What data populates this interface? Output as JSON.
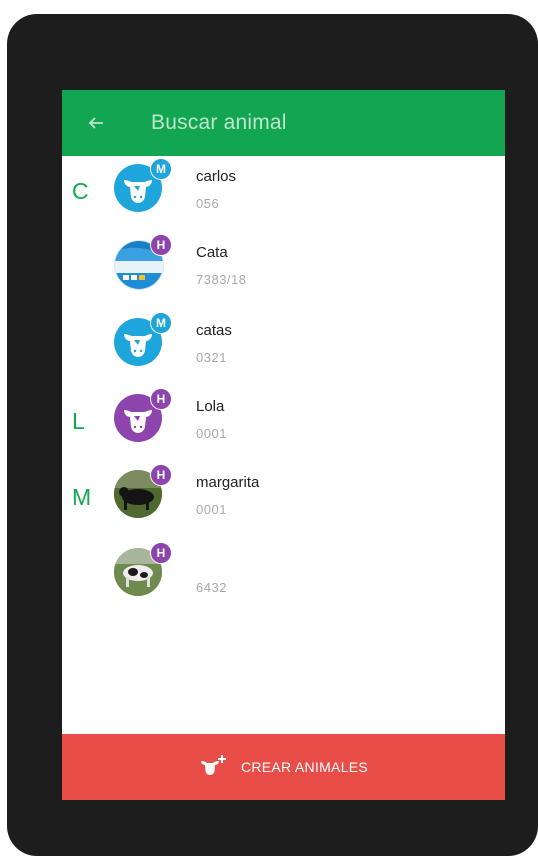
{
  "header": {
    "title": "Buscar animal",
    "back_icon": "arrow-back-icon"
  },
  "colors": {
    "primary": "#12a552",
    "accent": "#e84d47",
    "male": "#1ea6dc",
    "female": "#8e44ad"
  },
  "animals": [
    {
      "section_letter": "C",
      "name": "carlos",
      "id": "056",
      "badge": "M",
      "avatar": "cow-icon"
    },
    {
      "section_letter": "",
      "name": "Cata",
      "id": "7383/18",
      "badge": "H",
      "avatar": "app-screenshot-photo"
    },
    {
      "section_letter": "",
      "name": "catas",
      "id": "0321",
      "badge": "M",
      "avatar": "cow-icon"
    },
    {
      "section_letter": "L",
      "name": "Lola",
      "id": "0001",
      "badge": "H",
      "avatar": "cow-icon"
    },
    {
      "section_letter": "M",
      "name": "margarita",
      "id": "0001",
      "badge": "H",
      "avatar": "black-cow-photo"
    },
    {
      "section_letter": "",
      "name": "",
      "id": "6432",
      "badge": "H",
      "avatar": "holstein-cow-photo"
    }
  ],
  "footer": {
    "label": "CREAR ANIMALES",
    "icon": "add-cow-icon"
  }
}
